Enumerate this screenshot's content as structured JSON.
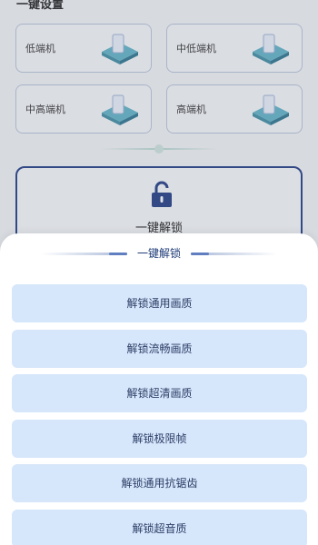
{
  "background": {
    "section_title": "一键设置",
    "tiers": [
      {
        "label": "低端机",
        "icon": "phone-device-icon"
      },
      {
        "label": "中低端机",
        "icon": "phone-device-icon"
      },
      {
        "label": "中高端机",
        "icon": "phone-device-icon"
      },
      {
        "label": "高端机",
        "icon": "phone-device-icon"
      }
    ],
    "unlock_card": {
      "label": "一键解锁",
      "icon": "unlock-icon"
    }
  },
  "sheet": {
    "title": "一键解锁",
    "options": [
      "解锁通用画质",
      "解锁流畅画质",
      "解锁超清画质",
      "解锁极限帧",
      "解锁通用抗锯齿",
      "解锁超音质"
    ]
  },
  "colors": {
    "accent": "#1f3c86",
    "option_bg": "#d6e6fb",
    "option_text": "#2c3e66"
  }
}
